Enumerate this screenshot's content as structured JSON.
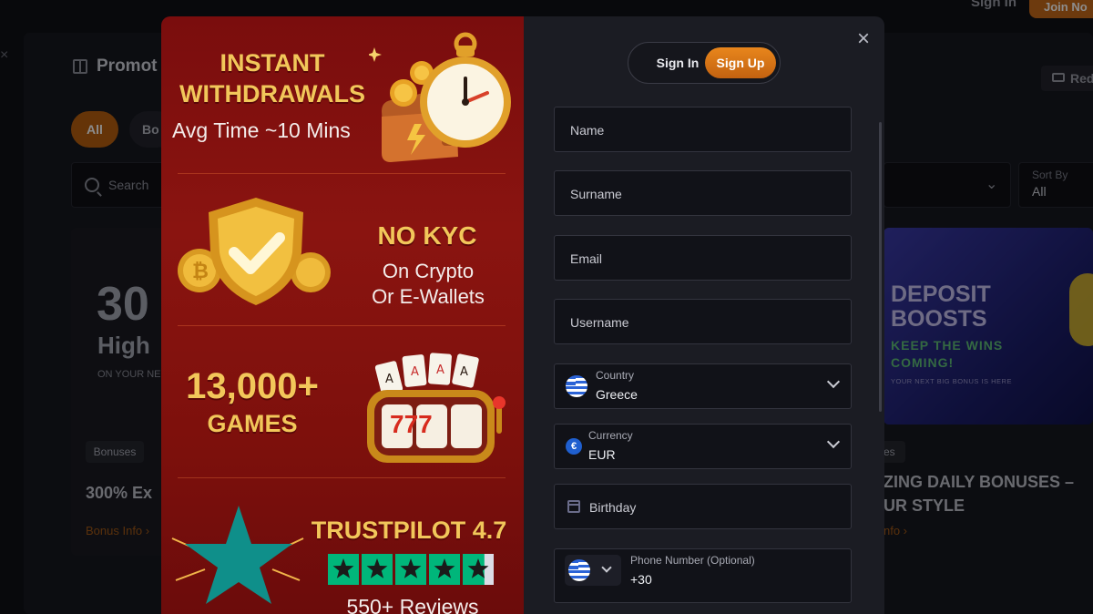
{
  "background": {
    "top_sign_in": "Sign In",
    "top_join": "Join No",
    "promotions_title": "Promot",
    "chips": [
      "All",
      "Bo"
    ],
    "search_placeholder": "Search",
    "sort_label": "Sort By",
    "sort_value": "All",
    "red_button": "Red",
    "hero_number": "30",
    "hero_word": "High",
    "hero_sub": "ON YOUR NE",
    "left_tag": "Bonuses",
    "left_card_title": "300% Ex",
    "left_card_link": "Bonus Info ›",
    "deposit_title": "DEPOSIT BOOSTS",
    "deposit_sub": "KEEP THE WINS COMING!",
    "deposit_small": "YOUR NEXT BIG BONUS IS HERE",
    "right_tag": "ses",
    "right_card_title": "ZING DAILY BONUSES – UR STYLE",
    "right_card_link": "nfo ›"
  },
  "promo": {
    "withdrawals_headline": "INSTANT WITHDRAWALS",
    "withdrawals_sub": "Avg Time ~10 Mins",
    "kyc_headline": "NO KYC",
    "kyc_sub_1": "On Crypto",
    "kyc_sub_2": "Or E-Wallets",
    "games_number": "13,000+",
    "games_word": "GAMES",
    "slot_digits": "777",
    "trustpilot_headline": "TRUSTPILOT 4.7",
    "trustpilot_rating": 4.7,
    "reviews": "550+ Reviews"
  },
  "form": {
    "close_icon": "close-icon",
    "sign_in_tab": "Sign In",
    "sign_up_tab": "Sign Up",
    "name_placeholder": "Name",
    "surname_placeholder": "Surname",
    "email_placeholder": "Email",
    "username_placeholder": "Username",
    "country_label": "Country",
    "country_value": "Greece",
    "currency_label": "Currency",
    "currency_value": "EUR",
    "currency_symbol": "€",
    "birthday_placeholder": "Birthday",
    "phone_label": "Phone Number (Optional)",
    "phone_code": "+30"
  },
  "colors": {
    "accent": "#d9761a",
    "promo_bg": "#7a0d0d",
    "headline_gold": "#f2c75a",
    "trustpilot_green": "#00b67a"
  }
}
